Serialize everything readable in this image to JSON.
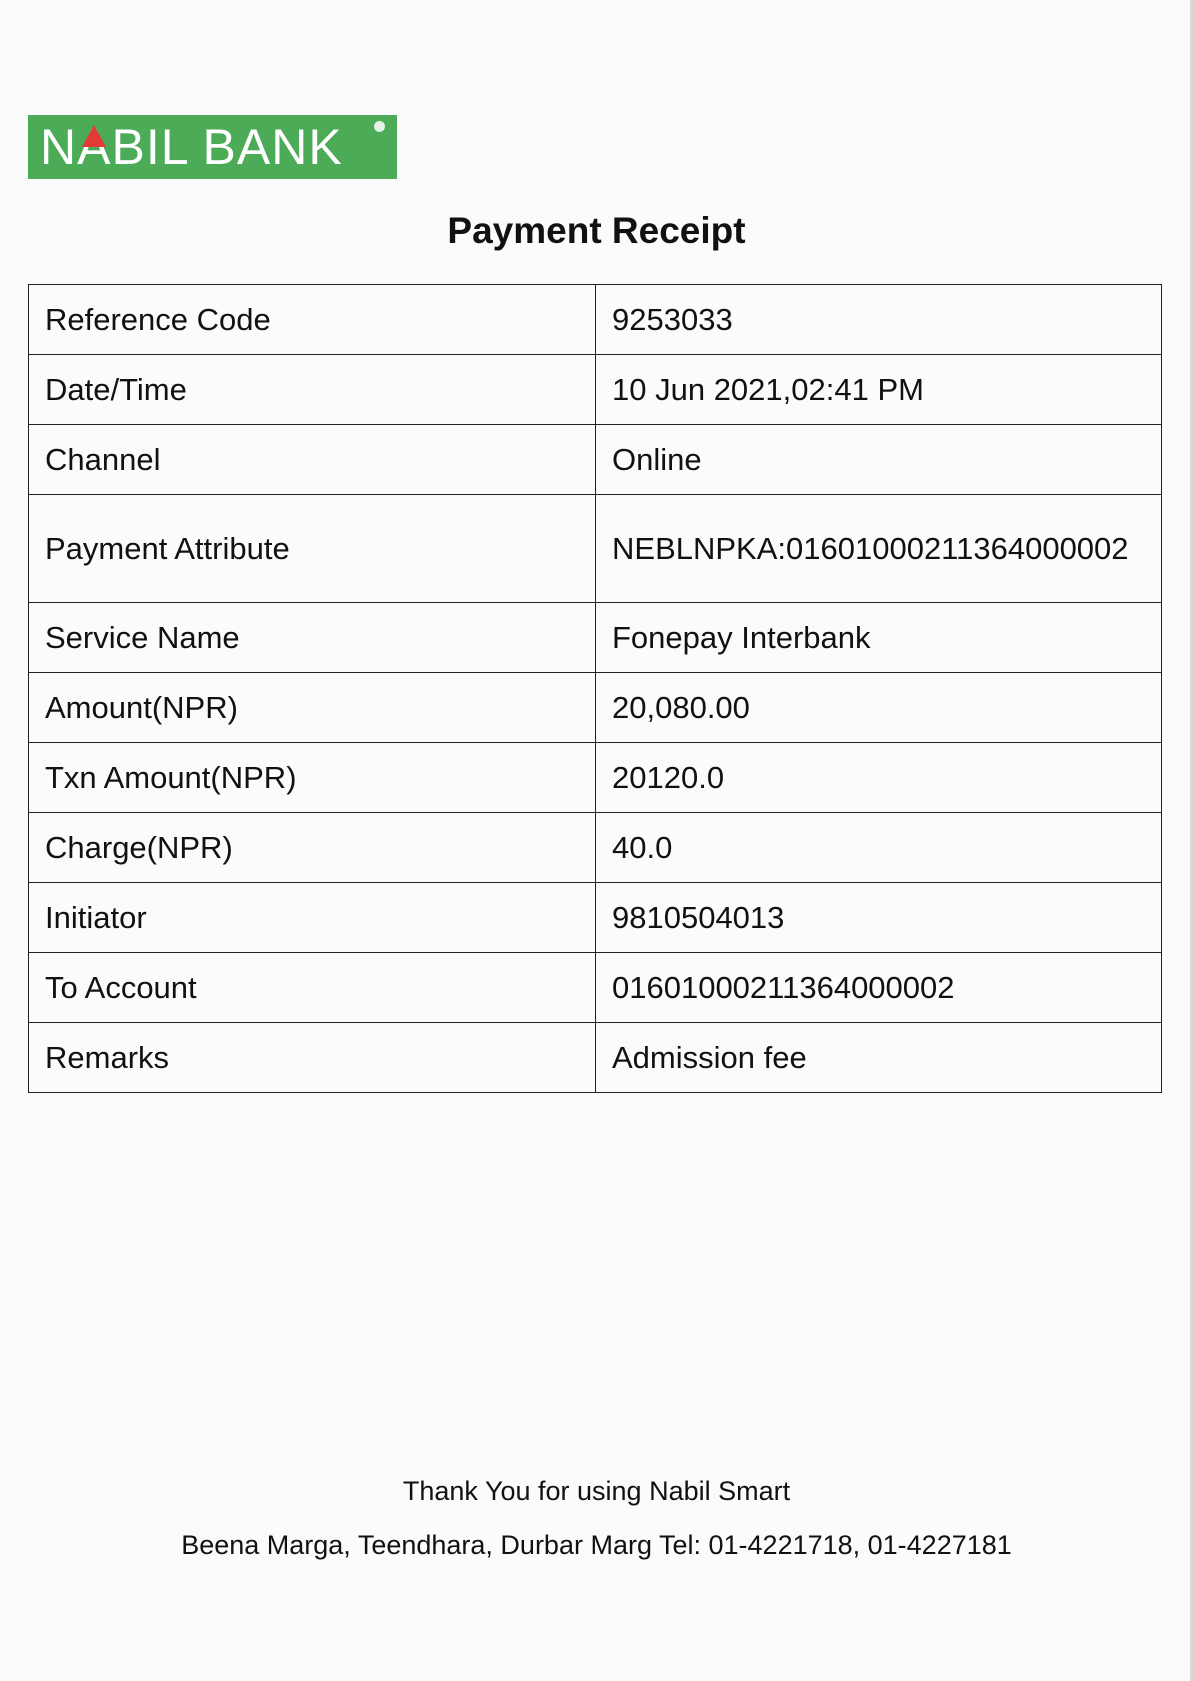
{
  "header": {
    "logo_text": "NABIL BANK",
    "logo_color": "#4bab57",
    "logo_accent_color": "#e23a36"
  },
  "title": "Payment Receipt",
  "rows": [
    {
      "label": "Reference Code",
      "value": "9253033"
    },
    {
      "label": "Date/Time",
      "value": "10 Jun 2021,02:41 PM"
    },
    {
      "label": "Channel",
      "value": "Online"
    },
    {
      "label": "Payment Attribute",
      "value": "NEBLNPKA:01601000211364000002"
    },
    {
      "label": "Service Name",
      "value": "Fonepay Interbank"
    },
    {
      "label": "Amount(NPR)",
      "value": "20,080.00"
    },
    {
      "label": "Txn Amount(NPR)",
      "value": "20120.0"
    },
    {
      "label": "Charge(NPR)",
      "value": "40.0"
    },
    {
      "label": "Initiator",
      "value": "9810504013"
    },
    {
      "label": "To Account",
      "value": "01601000211364000002"
    },
    {
      "label": "Remarks",
      "value": "Admission fee"
    }
  ],
  "footer": {
    "thanks": "Thank You for using Nabil Smart",
    "address": "Beena Marga, Teendhara, Durbar Marg Tel: 01-4221718, 01-4227181"
  }
}
